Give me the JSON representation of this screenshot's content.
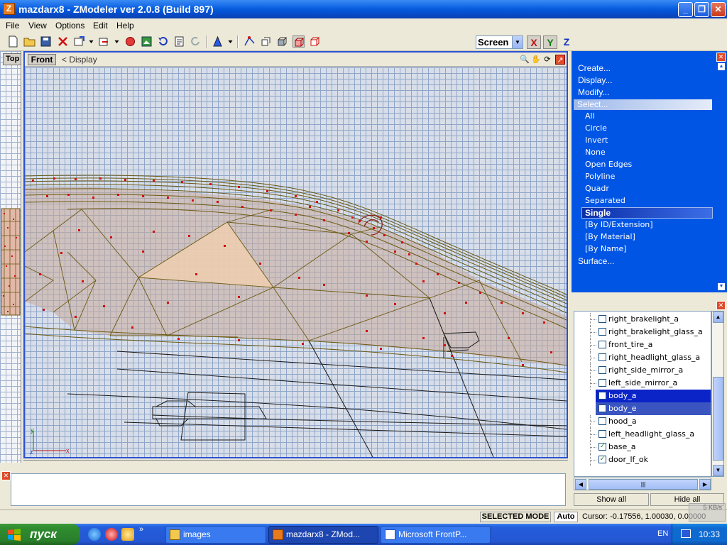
{
  "window": {
    "title": "mazdarx8 - ZModeler ver 2.0.8 (Build 897)",
    "app_icon": "Z",
    "minimize_icon": "minimize-icon",
    "restore_icon": "restore-icon",
    "close_icon": "close-icon"
  },
  "menu": [
    {
      "label": "File"
    },
    {
      "label": "View"
    },
    {
      "label": "Options"
    },
    {
      "label": "Edit"
    },
    {
      "label": "Help"
    }
  ],
  "toolbar": {
    "view_mode": "Screen",
    "axis_x": "X",
    "axis_y": "Y",
    "axis_z": "Z"
  },
  "viewports": {
    "left_tab": "Top",
    "main_tab": "Front",
    "main_menu": "< Display",
    "bottom_tab": "",
    "axis_y_label": "y",
    "axis_x_label": "x",
    "axis_z_label": "z"
  },
  "commands": {
    "items": [
      "Create...",
      "Display...",
      "Modify..."
    ],
    "select_header": "Select...",
    "select_sub": [
      "All",
      "Circle",
      "Invert",
      "None",
      "Open Edges",
      "Polyline",
      "Quadr",
      "Separated"
    ],
    "selected_sub": "Single",
    "select_sub2": [
      "[By ID/Extension]",
      "[By Material]",
      "[By Name]"
    ],
    "surface": "Surface..."
  },
  "objects": {
    "rows": [
      {
        "name": "right_brakelight_a",
        "checked": false,
        "state": "normal"
      },
      {
        "name": "right_brakelight_glass_a",
        "checked": false,
        "state": "normal"
      },
      {
        "name": "front_tire_a",
        "checked": false,
        "state": "normal"
      },
      {
        "name": "right_headlight_glass_a",
        "checked": false,
        "state": "normal"
      },
      {
        "name": "right_side_mirror_a",
        "checked": false,
        "state": "normal"
      },
      {
        "name": "left_side_mirror_a",
        "checked": false,
        "state": "normal"
      },
      {
        "name": "body_a",
        "checked": false,
        "state": "selected"
      },
      {
        "name": "body_e",
        "checked": false,
        "state": "selected-secondary"
      },
      {
        "name": "hood_a",
        "checked": false,
        "state": "normal"
      },
      {
        "name": "left_headlight_glass_a",
        "checked": false,
        "state": "normal"
      },
      {
        "name": "base_a",
        "checked": true,
        "state": "normal"
      },
      {
        "name": "door_lf_ok",
        "checked": true,
        "state": "normal"
      }
    ],
    "show_all": "Show all",
    "hide_all": "Hide all"
  },
  "status": {
    "mode": "SELECTED MODE",
    "auto": "Auto",
    "cursor": "Cursor: -0.17556, 1.00030, 0.00000",
    "net_speed": "5 KB/s"
  },
  "taskbar": {
    "start": "пуск",
    "tasks": [
      {
        "label": "images",
        "icon": "folder-icon"
      },
      {
        "label": "mazdarx8 - ZMod...",
        "icon": "zmodeler-icon"
      },
      {
        "label": "Microsoft FrontP...",
        "icon": "frontpage-icon"
      }
    ],
    "lang": "EN",
    "clock": "10:33"
  },
  "colors": {
    "accent_blue": "#0055e5",
    "selection": "#0a24c8",
    "mesh_edge": "#6b5a12",
    "vertex": "#d01010",
    "face_fill": "#c9a99a"
  }
}
